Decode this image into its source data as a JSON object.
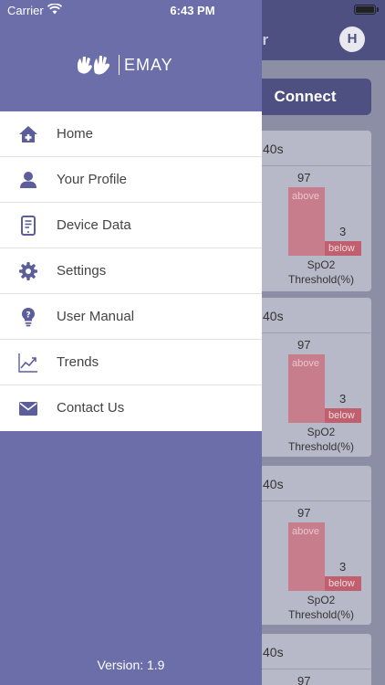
{
  "status_bar": {
    "carrier": "Carrier",
    "time": "6:43 PM"
  },
  "background_screen": {
    "header_title_partial": "er",
    "avatar_initial": "H",
    "connect_label": "Connect",
    "cards": [
      {
        "title_partial": "40s",
        "above_value": "97",
        "above_label": "above",
        "below_value": "3",
        "below_label": "below",
        "caption_line1": "SpO2",
        "caption_line2": "Threshold(%)"
      },
      {
        "title_partial": "40s",
        "above_value": "97",
        "above_label": "above",
        "below_value": "3",
        "below_label": "below",
        "caption_line1": "SpO2",
        "caption_line2": "Threshold(%)"
      },
      {
        "title_partial": "40s",
        "above_value": "97",
        "above_label": "above",
        "below_value": "3",
        "below_label": "below",
        "caption_line1": "SpO2",
        "caption_line2": "Threshold(%)"
      },
      {
        "title_partial": "40s",
        "above_value": "97"
      }
    ]
  },
  "drawer": {
    "logo_text": "EMAY",
    "menu": [
      {
        "label": "Home",
        "icon": "home-icon"
      },
      {
        "label": "Your Profile",
        "icon": "profile-icon"
      },
      {
        "label": "Device Data",
        "icon": "device-icon"
      },
      {
        "label": "Settings",
        "icon": "gear-icon"
      },
      {
        "label": "User Manual",
        "icon": "lightbulb-icon"
      },
      {
        "label": "Trends",
        "icon": "trend-icon"
      },
      {
        "label": "Contact Us",
        "icon": "mail-icon"
      }
    ],
    "version": "Version: 1.9"
  },
  "colors": {
    "drawer_bg": "#6b6ea8",
    "header_bg": "#4d5080",
    "icon": "#5b5e9a",
    "bar_above": "#c87d8c",
    "bar_below": "#c0606e"
  }
}
